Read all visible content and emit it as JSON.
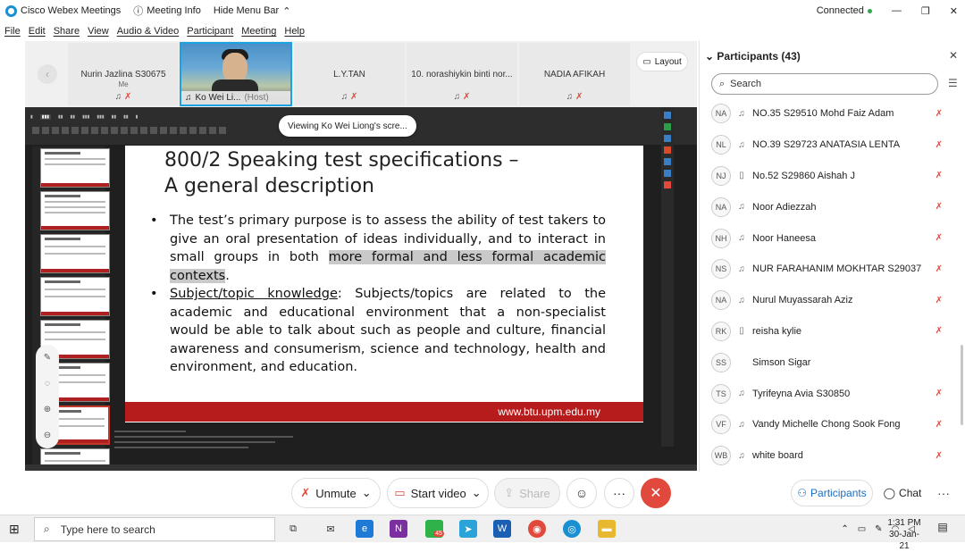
{
  "window": {
    "app_title": "Cisco Webex Meetings",
    "meeting_info": "Meeting Info",
    "hide_menu": "Hide Menu Bar",
    "connection": "Connected",
    "minimize": "—",
    "maximize": "❐",
    "close": "✕"
  },
  "menu": [
    "File",
    "Edit",
    "Share",
    "View",
    "Audio & Video",
    "Participant",
    "Meeting",
    "Help"
  ],
  "thumbnails": [
    {
      "name": "Nurin Jazlina S30675",
      "sub": "Me"
    },
    {
      "name": "L.Y.TAN",
      "sub": ""
    },
    {
      "name": "10. norashiykin binti nor...",
      "sub": ""
    },
    {
      "name": "NADIA AFIKAH",
      "sub": ""
    }
  ],
  "host_thumb": {
    "name": "Ko Wei Li...",
    "role": "(Host)"
  },
  "layout_label": "Layout",
  "viewing_label": "Viewing Ko Wei Liong's scre...",
  "slide": {
    "title_line1": "800/2 Speaking test specifications –",
    "title_line2": "A general description",
    "b1_pre": "The test’s primary purpose is to assess the ability of test takers to give an oral presentation of ideas individually, and to interact in small groups in both ",
    "b1_hl": "more formal and less formal academic contexts",
    "b1_post": ".",
    "b2_ul": "Subject/topic knowledge",
    "b2_post": ": Subjects/topics are related to the academic and educational environment that a non-specialist would be able to talk about such as people and culture, financial awareness and consumerism, science and technology, health and environment, and education.",
    "footer": "www.btu.upm.edu.my"
  },
  "controls": {
    "unmute": "Unmute",
    "start_video": "Start video",
    "share": "Share",
    "more": "···",
    "end": "✕"
  },
  "participants_panel": {
    "title": "Participants (43)",
    "search_placeholder": "Search",
    "items": [
      {
        "initials": "NA",
        "name": "NO.35 S29510 Mohd Faiz Adam",
        "device": "headset"
      },
      {
        "initials": "NL",
        "name": "NO.39 S29723 ANATASIA LENTA",
        "device": "headset"
      },
      {
        "initials": "NJ",
        "name": "No.52 S29860 Aishah J",
        "device": "phone"
      },
      {
        "initials": "NA",
        "name": "Noor Adiezzah",
        "device": "headset"
      },
      {
        "initials": "NH",
        "name": "Noor Haneesa",
        "device": "headset"
      },
      {
        "initials": "NS",
        "name": "NUR FARAHANIM MOKHTAR S29037",
        "device": "headset"
      },
      {
        "initials": "NA",
        "name": "Nurul Muyassarah Aziz",
        "device": "headset"
      },
      {
        "initials": "RK",
        "name": "reisha kylie",
        "device": "phone"
      },
      {
        "initials": "SS",
        "name": "Simson Sigar",
        "device": "none"
      },
      {
        "initials": "TS",
        "name": "Tyrifeyna Avia S30850",
        "device": "headset"
      },
      {
        "initials": "VF",
        "name": "Vandy Michelle Chong Sook Fong",
        "device": "headset"
      },
      {
        "initials": "WB",
        "name": "white board",
        "device": "headset"
      }
    ],
    "tab_participants": "Participants",
    "tab_chat": "Chat",
    "tab_more": "···"
  },
  "taskbar": {
    "search_placeholder": "Type here to search",
    "time": "1:31 PM",
    "date": "30-Jan-21",
    "whatsapp_badge": "45"
  },
  "colors": {
    "accent": "#1a6ec1",
    "danger": "#e0493c",
    "slide_band": "#b71c1c",
    "connected": "#2fa84f"
  }
}
